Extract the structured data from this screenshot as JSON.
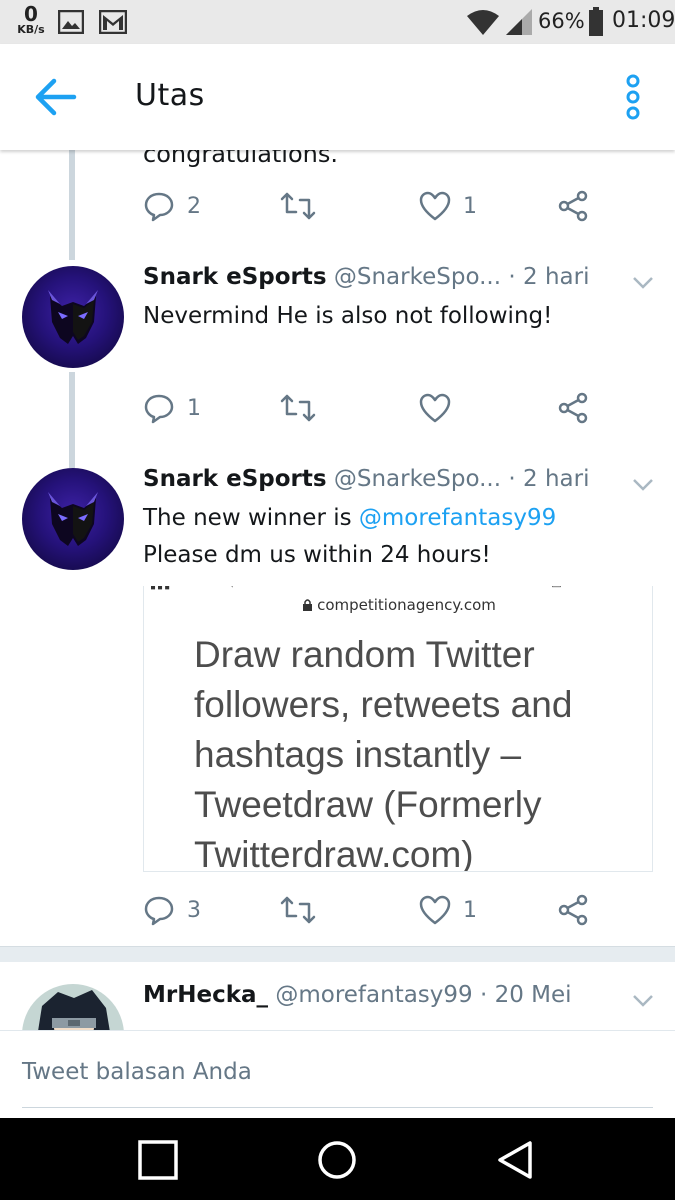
{
  "status_bar": {
    "net_speed_value": "0",
    "net_speed_unit": "KB/s",
    "battery": "66%",
    "time": "01:09",
    "icons": [
      "gallery-icon",
      "gmail-icon",
      "wifi-icon",
      "signal-icon",
      "battery-icon"
    ]
  },
  "app_bar": {
    "title": "Utas",
    "accent": "#1da1f2"
  },
  "partial_tweet": {
    "text_fragment": "congratulations.",
    "reply_count": "2",
    "retweet_count": "",
    "like_count": "1"
  },
  "tweets": [
    {
      "name": "Snark eSports",
      "handle": "@SnarkeSpo...",
      "time": "· 2 hari",
      "body": "Nevermind He is also not following!",
      "reply_count": "1",
      "retweet_count": "",
      "like_count": ""
    },
    {
      "name": "Snark eSports",
      "handle": "@SnarkeSpo...",
      "time": "· 2 hari",
      "body_prefix": "The new winner is ",
      "mention": "@morefantasy99",
      "body_line2": "Please dm us within 24 hours!",
      "card": {
        "url": "competitionagency.com",
        "headline": "Draw random Twitter followers, retweets and hashtags instantly – Tweetdraw (Formerly Twitterdraw.com)"
      },
      "reply_count": "3",
      "retweet_count": "",
      "like_count": "1"
    },
    {
      "name": "MrHecka_",
      "handle": "@morefantasy99",
      "time": "· 20 Mei"
    }
  ],
  "reply_bar": {
    "placeholder": "Tweet balasan Anda"
  },
  "nav_bar": {
    "buttons": [
      "recents-button",
      "home-button",
      "back-button"
    ]
  }
}
